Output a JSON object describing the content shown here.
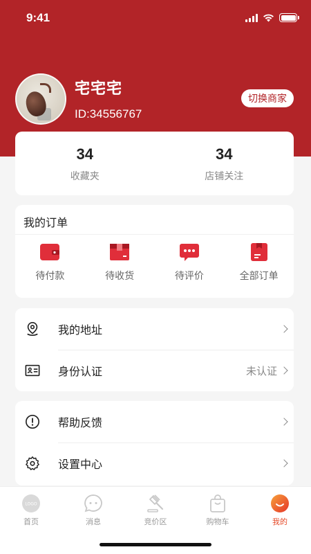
{
  "status_bar": {
    "time": "9:41"
  },
  "profile": {
    "name": "宅宅宅",
    "id_text": "ID:34556767",
    "switch_label": "切换商家"
  },
  "stats": [
    {
      "value": "34",
      "label": "收藏夹"
    },
    {
      "value": "34",
      "label": "店铺关注"
    }
  ],
  "orders": {
    "title": "我的订单",
    "items": [
      {
        "label": "待付款",
        "icon": "wallet-icon"
      },
      {
        "label": "待收货",
        "icon": "package-icon"
      },
      {
        "label": "待评价",
        "icon": "comment-icon"
      },
      {
        "label": "全部订单",
        "icon": "order-list-icon"
      }
    ]
  },
  "menu": {
    "address": {
      "label": "我的地址",
      "icon": "location-icon"
    },
    "identity": {
      "label": "身份认证",
      "status": "未认证",
      "icon": "id-card-icon"
    },
    "help": {
      "label": "帮助反馈",
      "icon": "info-icon"
    },
    "settings": {
      "label": "设置中心",
      "icon": "gear-icon"
    }
  },
  "tabs": [
    {
      "label": "首页",
      "icon": "logo-icon"
    },
    {
      "label": "消息",
      "icon": "chat-icon"
    },
    {
      "label": "竞价区",
      "icon": "auction-icon"
    },
    {
      "label": "购物车",
      "icon": "bag-icon"
    },
    {
      "label": "我的",
      "icon": "profile-icon",
      "active": true
    }
  ],
  "colors": {
    "brand": "#b22428",
    "active_tab": "#e54b2a",
    "icon_red": "#e02e3a"
  }
}
